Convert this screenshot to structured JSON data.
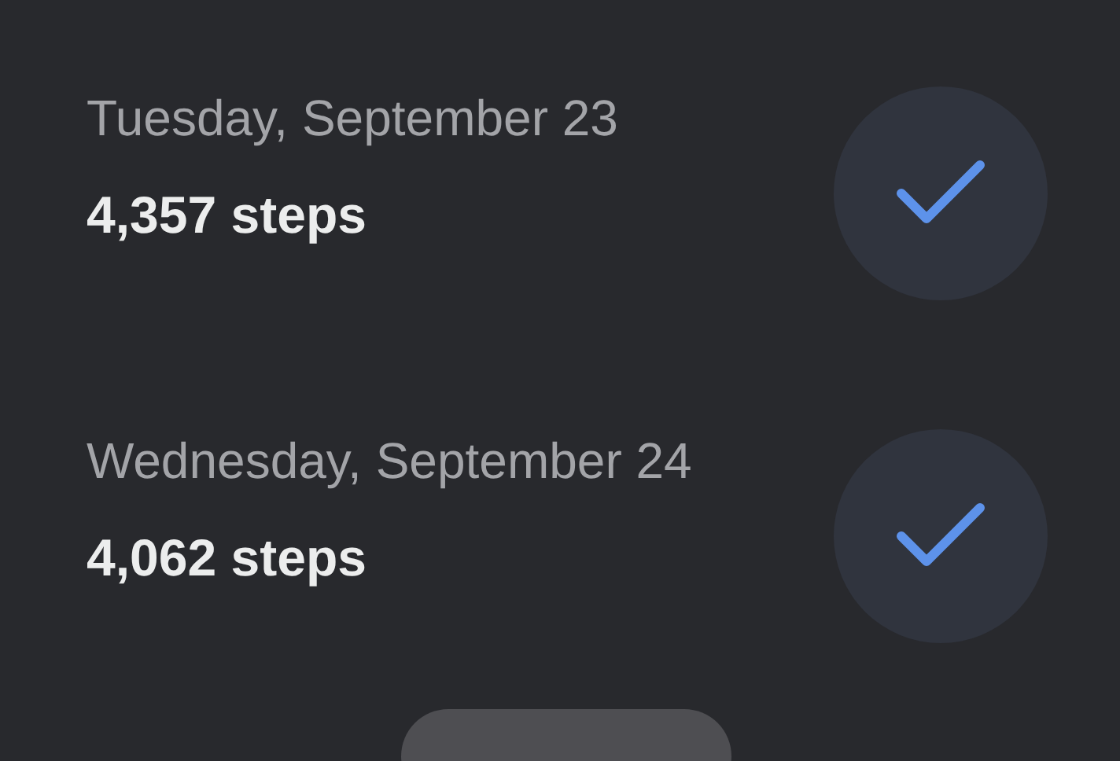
{
  "days": [
    {
      "date": "Tuesday, September 23",
      "steps": "4,357 steps",
      "completed": true
    },
    {
      "date": "Wednesday, September 24",
      "steps": "4,062 steps",
      "completed": true
    }
  ]
}
